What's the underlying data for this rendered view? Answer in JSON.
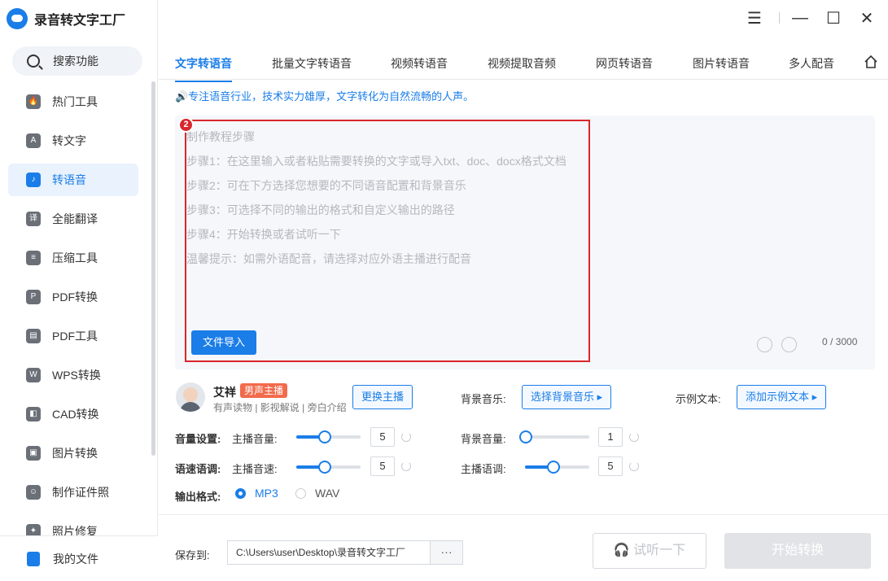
{
  "app": {
    "title": "录音转文字工厂"
  },
  "sidebar": {
    "search_label": "搜索功能",
    "items": [
      {
        "label": "热门工具",
        "icon": "fire-icon",
        "glyph": "🔥"
      },
      {
        "label": "转文字",
        "icon": "text-icon",
        "glyph": "A"
      },
      {
        "label": "转语音",
        "icon": "voice-icon",
        "glyph": "♪"
      },
      {
        "label": "全能翻译",
        "icon": "translate-icon",
        "glyph": "译"
      },
      {
        "label": "压缩工具",
        "icon": "compress-icon",
        "glyph": "≡"
      },
      {
        "label": "PDF转换",
        "icon": "pdf-icon",
        "glyph": "P"
      },
      {
        "label": "PDF工具",
        "icon": "toolbox-icon",
        "glyph": "▤"
      },
      {
        "label": "WPS转换",
        "icon": "wps-icon",
        "glyph": "W"
      },
      {
        "label": "CAD转换",
        "icon": "cad-icon",
        "glyph": "◧"
      },
      {
        "label": "图片转换",
        "icon": "image-icon",
        "glyph": "▣"
      },
      {
        "label": "制作证件照",
        "icon": "id-photo-icon",
        "glyph": "☺"
      },
      {
        "label": "照片修复",
        "icon": "photo-repair-icon",
        "glyph": "✦"
      }
    ],
    "my_files_label": "我的文件"
  },
  "window": {
    "menu": "☰",
    "minimize": "—",
    "maximize": "☐",
    "close": "✕"
  },
  "tabs": [
    "文字转语音",
    "批量文字转语音",
    "视频转语音",
    "视频提取音频",
    "网页转语音",
    "图片转语音",
    "多人配音"
  ],
  "slogan": "🔊专注语音行业，技术实力雄厚，文字转化为自然流畅的人声。",
  "editor": {
    "badge": "2",
    "placeholder_lines": [
      "制作教程步骤",
      "步骤1：在这里输入或者粘贴需要转换的文字或导入txt、doc、docx格式文档",
      "步骤2：可在下方选择您想要的不同语音配置和背景音乐",
      "步骤3：可选择不同的输出的格式和自定义输出的路径",
      "步骤4：开始转换或者试听一下",
      "温馨提示：如需外语配音，请选择对应外语主播进行配音"
    ],
    "import_button": "文件导入",
    "counter": "0 / 3000"
  },
  "voice": {
    "name": "艾祥",
    "tag": "男声主播",
    "desc": "有声读物 | 影视解说 | 旁白介绍",
    "change_button": "更换主播"
  },
  "bgm": {
    "label": "背景音乐:",
    "button": "选择背景音乐 ▸"
  },
  "sample": {
    "label": "示例文本:",
    "button": "添加示例文本 ▸"
  },
  "volume": {
    "label": "音量设置:",
    "host_label": "主播音量:",
    "host_value": "5",
    "bg_label": "背景音量:",
    "bg_value": "1"
  },
  "speed": {
    "label": "语速语调:",
    "speed_label": "主播音速:",
    "speed_value": "5",
    "pitch_label": "主播语调:",
    "pitch_value": "5"
  },
  "output": {
    "label": "输出格式:",
    "options": [
      "MP3",
      "WAV"
    ],
    "selected": "MP3"
  },
  "save": {
    "label": "保存到:",
    "path": "C:\\Users\\user\\Desktop\\录音转文字工厂",
    "more": "···"
  },
  "actions": {
    "preview": "试听一下",
    "start": "开始转换"
  },
  "colors": {
    "accent": "#1a7de8",
    "highlight": "#d9262c",
    "tag": "#f26b4c"
  }
}
